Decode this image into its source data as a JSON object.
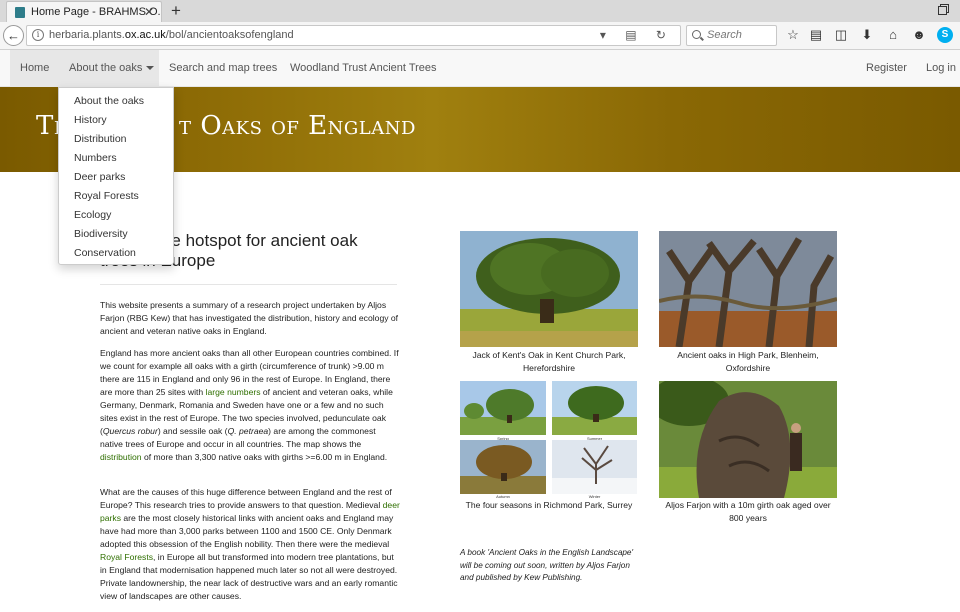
{
  "browser": {
    "tab_title": "Home Page - BRAHMS O...",
    "tab_close": "✕",
    "new_tab": "+",
    "url_prefix": "herbaria.plants.",
    "url_domain": "ox.ac.uk",
    "url_path": "/bol/ancientoaksofengland",
    "search_placeholder": "Search"
  },
  "nav": {
    "home": "Home",
    "about": "About the oaks",
    "search_map": "Search and map trees",
    "woodland": "Woodland Trust Ancient Trees",
    "register": "Register",
    "login": "Log in"
  },
  "banner": {
    "title_left": "Th",
    "title_right": "t Oaks of England"
  },
  "dropdown": {
    "items": [
      "About the oaks",
      "History",
      "Distribution",
      "Numbers",
      "Deer parks",
      "Royal Forests",
      "Ecology",
      "Biodiversity",
      "Conservation"
    ]
  },
  "main": {
    "heading_line1": "s the hotspot for ancient oak",
    "heading_line2": "trees in Europe",
    "p1": "This website presents a summary of a research project undertaken by Aljos Farjon (RBG Kew) that has investigated the distribution, history and ecology of ancient and veteran native oaks in England.",
    "p2_a": "England has more ancient oaks than all other European countries combined. If we count for example all oaks with a girth (circumference of trunk) >9.00 m there are 115 in England and only 96 in the rest of Europe. In England, there are more than 25 sites with ",
    "p2_link1": "large numbers",
    "p2_b": " of ancient and veteran oaks, while Germany, Denmark, Romania and Sweden have one or a few and no such sites exist in the rest of Europe. The two species involved, pedunculate oak (",
    "p2_i1": "Quercus robur",
    "p2_c": ") and sessile oak (",
    "p2_i2": "Q. petraea",
    "p2_d": ") are among the commonest native trees of Europe and occur in all countries. The map shows the ",
    "p2_link2": "distribution",
    "p2_e": " of more than 3,300 native oaks with girths >=6.00 m in England.",
    "p3_a": "What are the causes of this huge difference between England and the rest of Europe? This research tries to provide answers to that question. Medieval ",
    "p3_link1": "deer parks",
    "p3_b": " are the most closely historical links with ancient oaks and England may have had more than 3,000 parks between 1100 and 1500 CE. Only Denmark adopted this obsession of the English nobility. Then there were the medieval ",
    "p3_link2": "Royal Forests",
    "p3_c": ", in Europe all but transformed into modern tree plantations, but in England that modernisation happened much later so not all were destroyed. Private landownership, the near lack of destructive wars and an early romantic view of landscapes are other causes."
  },
  "photos": {
    "cap1": "Jack of Kent's Oak in Kent Church Park, Herefordshire",
    "cap2": "Ancient oaks in High Park, Blenheim, Oxfordshire",
    "cap3": "The four seasons in Richmond Park, Surrey",
    "cap4": "Aljos Farjon with a 10m girth oak aged over 800 years",
    "season1": "Spring",
    "season2": "Summer",
    "season3": "Autumn",
    "season4": "Winter",
    "book_note": "A book 'Ancient Oaks in the English Landscape' will be coming out soon, written by Aljos Farjon and published by Kew Publishing."
  }
}
